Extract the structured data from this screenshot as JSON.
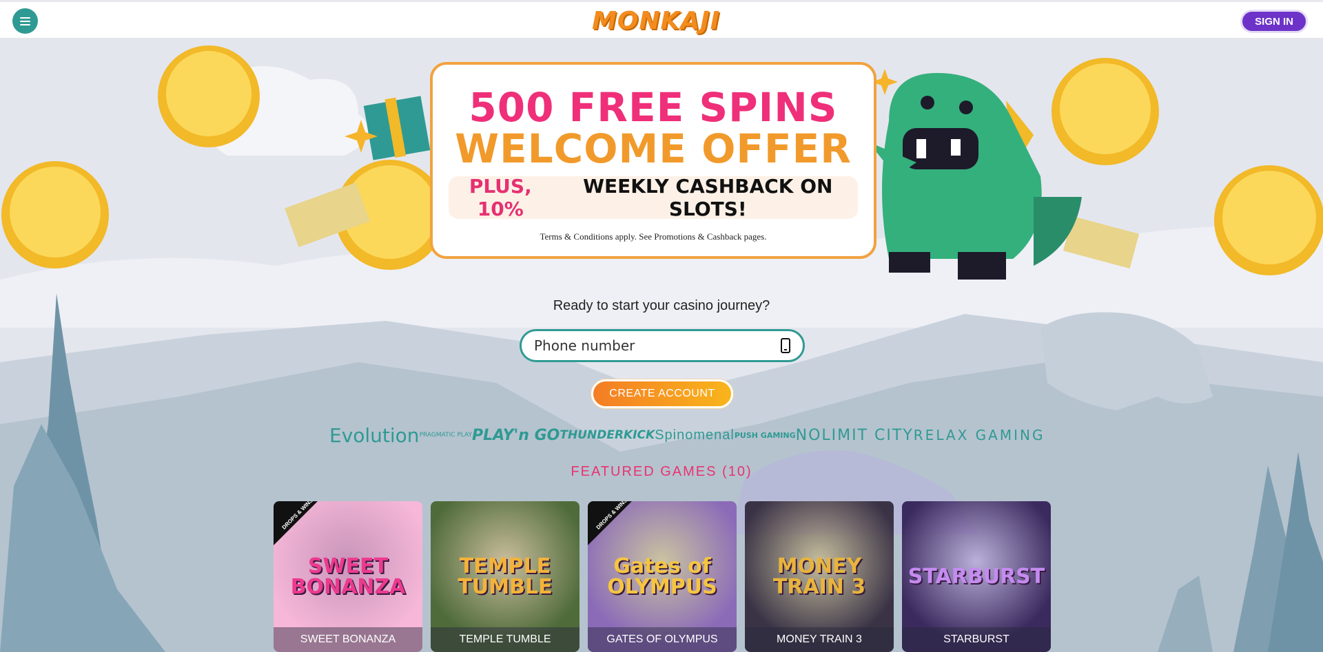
{
  "header": {
    "logo_text": "MONKAJI",
    "signin_label": "SIGN IN"
  },
  "promo": {
    "line1": "500 FREE SPINS",
    "line2": "WELCOME OFFER",
    "cash_highlight": "PLUS, 10%",
    "cash_rest": "WEEKLY CASHBACK ON SLOTS!",
    "terms": "Terms & Conditions apply. See Promotions & Cashback pages."
  },
  "signup": {
    "prompt": "Ready to start your casino journey?",
    "phone_placeholder": "Phone number",
    "create_label": "CREATE ACCOUNT"
  },
  "providers": [
    {
      "label": "Evolution",
      "icon": "evolution-logo"
    },
    {
      "label": "PRAGMATIC PLAY",
      "icon": "pragmatic-play-logo"
    },
    {
      "label": "PLAY'n GO",
      "icon": "playngo-logo"
    },
    {
      "label": "THUNDERKICK",
      "icon": "thunderkick-logo"
    },
    {
      "label": "Spinomenal",
      "icon": "spinomenal-logo"
    },
    {
      "label": "PUSH GAMING",
      "icon": "push-gaming-logo"
    },
    {
      "label": "NOLIMIT CITY",
      "icon": "nolimit-city-logo"
    },
    {
      "label": "RELAX GAMING",
      "icon": "relax-gaming-logo"
    }
  ],
  "featured": {
    "title": "FEATURED GAMES (10)",
    "badge": "DROPS & WINS",
    "games": [
      {
        "name": "SWEET BONANZA",
        "logo": "SWEET BONANZA",
        "bg": "#f6b7d8",
        "accent": "#ec3a8f",
        "drops_wins": true
      },
      {
        "name": "TEMPLE TUMBLE",
        "logo": "TEMPLE TUMBLE",
        "bg": "#4f6b3a",
        "accent": "#f3b33a",
        "drops_wins": false
      },
      {
        "name": "GATES OF OLYMPUS",
        "logo": "Gates of OLYMPUS",
        "bg": "#8b6bb8",
        "accent": "#f5c542",
        "drops_wins": true
      },
      {
        "name": "MONEY TRAIN 3",
        "logo": "MONEY TRAIN 3",
        "bg": "#3a3346",
        "accent": "#e8b43c",
        "drops_wins": false
      },
      {
        "name": "STARBURST",
        "logo": "STARBURST",
        "bg": "#3b2a5e",
        "accent": "#c58bf0",
        "drops_wins": false
      }
    ]
  }
}
